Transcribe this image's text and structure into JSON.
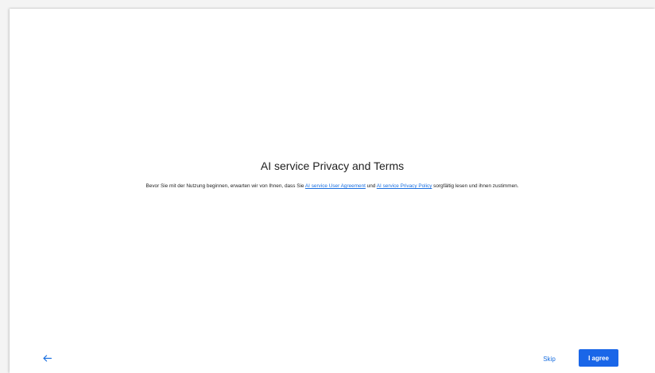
{
  "dialog": {
    "title": "AI service Privacy and Terms",
    "body_prefix": "Bevor Sie mit der Nutzung beginnen, erwarten wir von Ihnen, dass Sie ",
    "agreement_link": "AI service User Agreement",
    "body_and": " und ",
    "privacy_link": "AI service Privacy Policy",
    "body_suffix": " sorgfältig lesen und ihnen zustimmen."
  },
  "footer": {
    "back_icon": "arrow-left-icon",
    "skip_label": "Skip",
    "agree_label": "I agree"
  },
  "colors": {
    "accent": "#1a66e8",
    "link": "#1a6fe0"
  }
}
